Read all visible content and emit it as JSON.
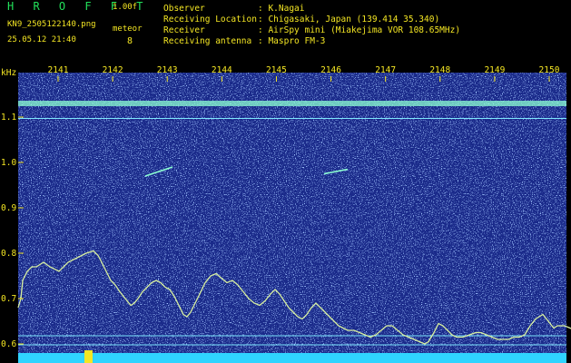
{
  "header": {
    "title": "H R O F F T",
    "version": "1.00f",
    "filename": "KN9_2505122140.png",
    "datetime": "25.05.12 21:40",
    "meteor_label": "meteor",
    "meteor_count": "8",
    "fields": [
      {
        "label": "Observer",
        "value": ": K.Nagai"
      },
      {
        "label": "Receiving Location",
        "value": ": Chigasaki, Japan (139.414 35.340)"
      },
      {
        "label": "Receiver",
        "value": ": AirSpy mini (Miakejima VOR 108.65MHz)"
      },
      {
        "label": "Receiving antenna",
        "value": ": Maspro FM-3"
      }
    ]
  },
  "chart_data": {
    "type": "heatmap",
    "ylabel": "kHz",
    "x_ticks": [
      "2141",
      "2142",
      "2143",
      "2144",
      "2145",
      "2146",
      "2147",
      "2148",
      "2149",
      "2150"
    ],
    "y_ticks": [
      "1.1",
      "1.0",
      "0.9",
      "0.8",
      "0.7",
      "0.6"
    ],
    "ylim": [
      0.58,
      1.19
    ],
    "colors": {
      "background": "#1a2a8a",
      "noise": "#4a6ee0",
      "trace": "#d8f0a0",
      "axis": "#f4e623"
    },
    "trace": [
      [
        0,
        0.68
      ],
      [
        3,
        0.7
      ],
      [
        5,
        0.74
      ],
      [
        10,
        0.76
      ],
      [
        15,
        0.77
      ],
      [
        20,
        0.77
      ],
      [
        28,
        0.78
      ],
      [
        35,
        0.77
      ],
      [
        45,
        0.76
      ],
      [
        55,
        0.78
      ],
      [
        65,
        0.79
      ],
      [
        75,
        0.8
      ],
      [
        83,
        0.805
      ],
      [
        88,
        0.795
      ],
      [
        92,
        0.78
      ],
      [
        97,
        0.76
      ],
      [
        102,
        0.74
      ],
      [
        107,
        0.73
      ],
      [
        112,
        0.715
      ],
      [
        118,
        0.7
      ],
      [
        124,
        0.685
      ],
      [
        128,
        0.69
      ],
      [
        132,
        0.7
      ],
      [
        137,
        0.715
      ],
      [
        142,
        0.725
      ],
      [
        147,
        0.735
      ],
      [
        152,
        0.74
      ],
      [
        157,
        0.735
      ],
      [
        162,
        0.725
      ],
      [
        167,
        0.72
      ],
      [
        172,
        0.705
      ],
      [
        177,
        0.685
      ],
      [
        182,
        0.665
      ],
      [
        186,
        0.66
      ],
      [
        190,
        0.67
      ],
      [
        195,
        0.69
      ],
      [
        200,
        0.71
      ],
      [
        206,
        0.735
      ],
      [
        212,
        0.75
      ],
      [
        218,
        0.755
      ],
      [
        224,
        0.745
      ],
      [
        230,
        0.735
      ],
      [
        236,
        0.74
      ],
      [
        242,
        0.73
      ],
      [
        248,
        0.715
      ],
      [
        254,
        0.7
      ],
      [
        260,
        0.69
      ],
      [
        266,
        0.685
      ],
      [
        272,
        0.695
      ],
      [
        278,
        0.71
      ],
      [
        283,
        0.72
      ],
      [
        288,
        0.71
      ],
      [
        293,
        0.695
      ],
      [
        298,
        0.68
      ],
      [
        303,
        0.67
      ],
      [
        308,
        0.66
      ],
      [
        313,
        0.655
      ],
      [
        318,
        0.665
      ],
      [
        323,
        0.68
      ],
      [
        328,
        0.69
      ],
      [
        333,
        0.68
      ],
      [
        338,
        0.67
      ],
      [
        343,
        0.66
      ],
      [
        348,
        0.65
      ],
      [
        353,
        0.64
      ],
      [
        358,
        0.635
      ],
      [
        363,
        0.63
      ],
      [
        370,
        0.63
      ],
      [
        376,
        0.625
      ],
      [
        382,
        0.62
      ],
      [
        388,
        0.615
      ],
      [
        394,
        0.62
      ],
      [
        400,
        0.63
      ],
      [
        406,
        0.64
      ],
      [
        412,
        0.64
      ],
      [
        418,
        0.63
      ],
      [
        424,
        0.62
      ],
      [
        430,
        0.615
      ],
      [
        436,
        0.61
      ],
      [
        442,
        0.605
      ],
      [
        448,
        0.6
      ],
      [
        452,
        0.605
      ],
      [
        458,
        0.625
      ],
      [
        463,
        0.645
      ],
      [
        468,
        0.64
      ],
      [
        473,
        0.63
      ],
      [
        478,
        0.62
      ],
      [
        483,
        0.615
      ],
      [
        490,
        0.615
      ],
      [
        497,
        0.62
      ],
      [
        504,
        0.625
      ],
      [
        510,
        0.625
      ],
      [
        516,
        0.62
      ],
      [
        522,
        0.615
      ],
      [
        528,
        0.61
      ],
      [
        534,
        0.61
      ],
      [
        540,
        0.61
      ],
      [
        546,
        0.615
      ],
      [
        552,
        0.615
      ],
      [
        558,
        0.62
      ],
      [
        564,
        0.64
      ],
      [
        570,
        0.655
      ],
      [
        574,
        0.66
      ],
      [
        578,
        0.665
      ],
      [
        582,
        0.655
      ],
      [
        586,
        0.645
      ],
      [
        590,
        0.635
      ],
      [
        594,
        0.64
      ],
      [
        598,
        0.64
      ],
      [
        602,
        0.64
      ],
      [
        608,
        0.635
      ],
      [
        614,
        0.63
      ],
      [
        619,
        0.625
      ]
    ],
    "echoes": [
      {
        "x1": 160,
        "y1": 0.97,
        "x2": 190,
        "y2": 0.99
      },
      {
        "x1": 357,
        "y1": 0.975,
        "x2": 383,
        "y2": 0.985
      }
    ]
  }
}
